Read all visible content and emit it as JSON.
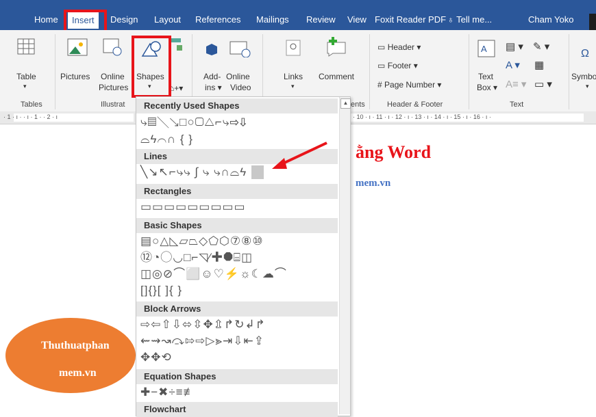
{
  "tabs": [
    "Home",
    "Insert",
    "Design",
    "Layout",
    "References",
    "Mailings",
    "Review",
    "View",
    "Foxit Reader PDF"
  ],
  "tell_me": "Tell me...",
  "user": "Cham Yoko",
  "ribbon": {
    "table": "Table",
    "pictures": "Pictures",
    "online_pictures_1": "Online",
    "online_pictures_2": "Pictures",
    "shapes": "Shapes",
    "addins": "Add-",
    "addins_2": "ins",
    "online_video_1": "Online",
    "online_video_2": "Video",
    "links": "Links",
    "comment": "Comment",
    "header": "Header",
    "footer": "Footer",
    "page_number": "Page Number",
    "text_box_1": "Text",
    "text_box_2": "Box",
    "symbol": "Symbo",
    "groups": {
      "tables": "Tables",
      "illustrations": "Illustrat",
      "comments": "ents",
      "header_footer": "Header & Footer",
      "text": "Text"
    }
  },
  "ruler": {
    "left": "· 1 · ı ·   · ı · 1 ·   · 2 · ı",
    "right": "· 10 · ı · 11 · ı · 12 · ı · 13 · ı · 14 · ı · 15 · ı · 16 · ı ·"
  },
  "document": {
    "title": "ằng Word",
    "subtitle": "mem.vn",
    "oval_line1": "Thuthuatphan",
    "oval_line2": "mem.vn"
  },
  "dropdown": {
    "sections": [
      {
        "title": "Recently Used Shapes",
        "rows": [
          "⤷▤╲↘□○▢△⌐⤷⇨⇩",
          "⌓ϟ⌒∩ {  }"
        ]
      },
      {
        "title": "Lines",
        "rows": [
          "╲↘↖⌐⤷⤷ ∫ ⤷ ⤷∩⌓ϟ"
        ]
      },
      {
        "title": "Rectangles",
        "rows": [
          "▭▭▭▭▭▭▭▭▭"
        ]
      },
      {
        "title": "Basic Shapes",
        "rows": [
          "▤○△◺▱⏢◇⬠⬡⑦⑧⑩",
          "⑫◔◯◡□⌐◹⁄✚⯃⌸◫",
          "◫◎⊘⌒⬜☺♡⚡☼☾☁⌒",
          "[]{}[  ]{  }"
        ]
      },
      {
        "title": "Block Arrows",
        "rows": [
          "⇨⇦⇧⇩⬄⇳✥⇫↱↻↲↱",
          "⇜⇝↝⤼⇰⇨▷⪢⇥⇩⇤⇪",
          "✥✥⟲"
        ]
      },
      {
        "title": "Equation Shapes",
        "rows": [
          "✚−✖÷≡≢"
        ]
      },
      {
        "title": "Flowchart",
        "rows": []
      }
    ]
  },
  "colors": {
    "accent": "#2b579a",
    "highlight": "#e8141a",
    "oval": "#ed7d31",
    "link": "#4472c4"
  }
}
